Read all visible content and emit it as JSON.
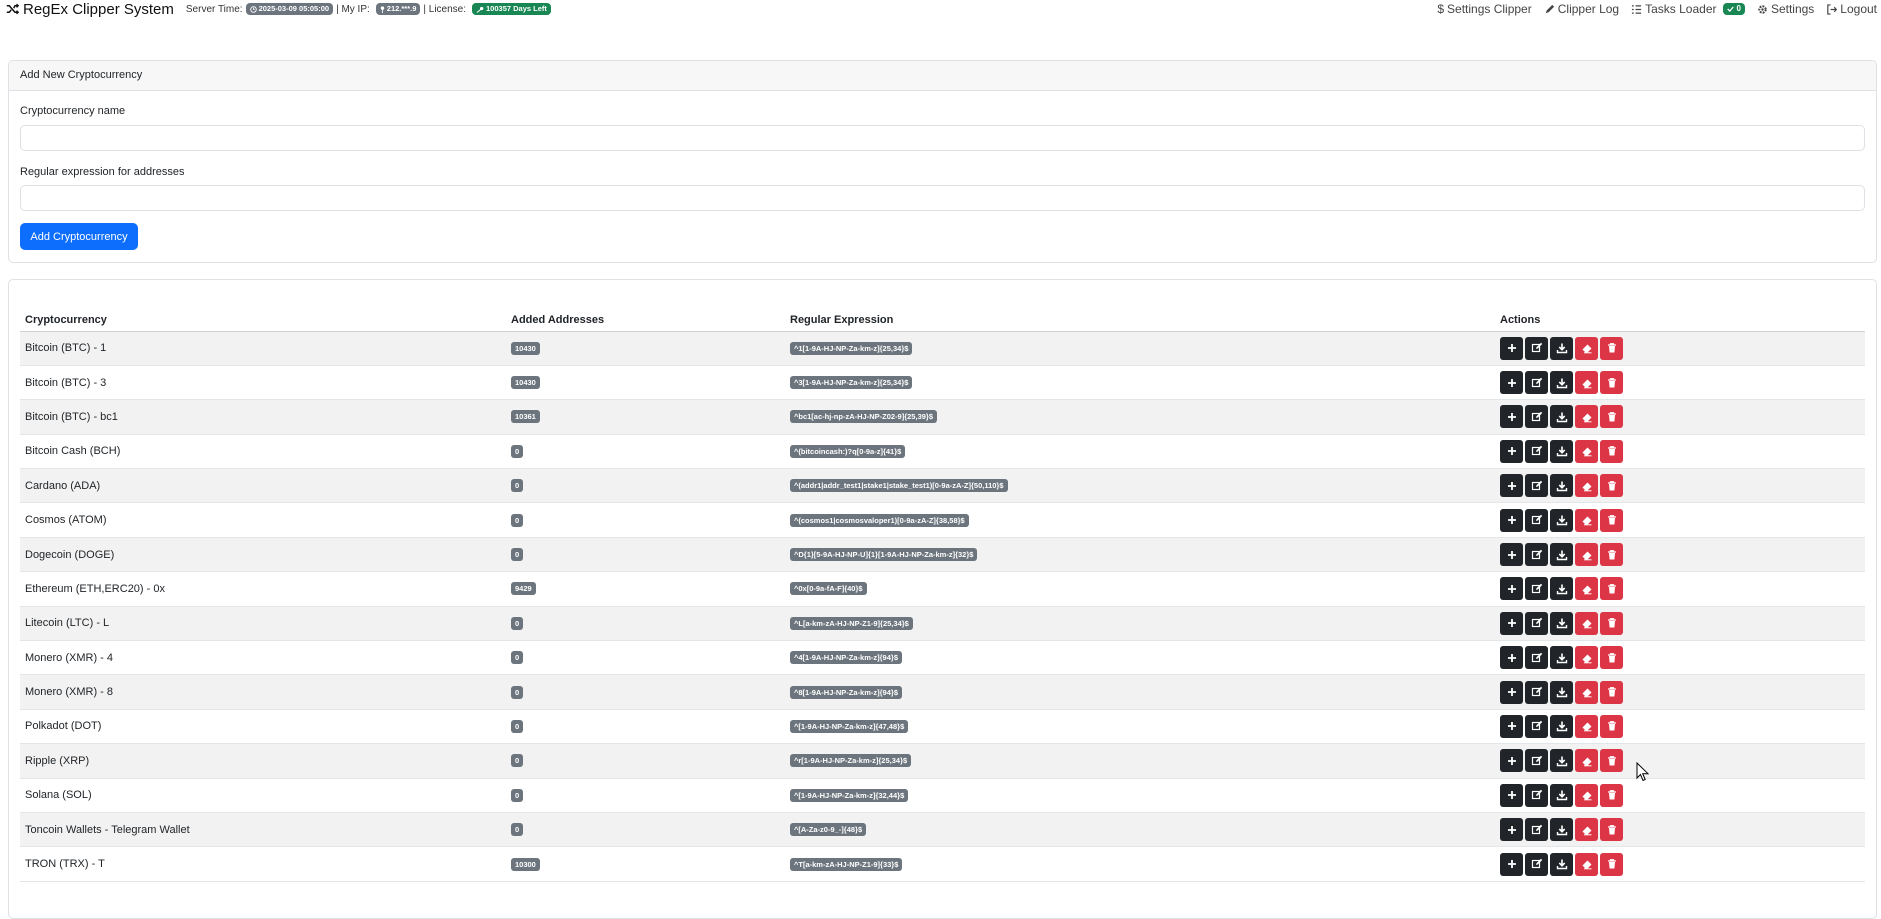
{
  "nav": {
    "brand": "RegEx Clipper System",
    "server_time_label": "Server Time:",
    "server_time": "2025-03-09 05:05:00",
    "ip_label": "| My IP:",
    "ip": "212.***.9",
    "license_label": "| License:",
    "license": "100357 Days Left",
    "links": {
      "settings_clipper": "Settings Clipper",
      "clipper_log": "Clipper Log",
      "tasks_loader": "Tasks Loader",
      "tasks_count": "0",
      "settings": "Settings",
      "logout": "Logout"
    }
  },
  "add_form": {
    "header": "Add New Cryptocurrency",
    "name_label": "Cryptocurrency name",
    "name_value": "",
    "regex_label": "Regular expression for addresses",
    "regex_value": "",
    "submit_label": "Add Cryptocurrency"
  },
  "table": {
    "columns": [
      "Cryptocurrency",
      "Added Addresses",
      "Regular Expression",
      "Actions"
    ],
    "rows": [
      {
        "name": "Bitcoin (BTC) - 1",
        "count": "10430",
        "regex": "^1[1-9A-HJ-NP-Za-km-z]{25,34}$"
      },
      {
        "name": "Bitcoin (BTC) - 3",
        "count": "10430",
        "regex": "^3[1-9A-HJ-NP-Za-km-z]{25,34}$"
      },
      {
        "name": "Bitcoin (BTC) - bc1",
        "count": "10361",
        "regex": "^bc1[ac-hj-np-zA-HJ-NP-Z02-9]{25,39}$"
      },
      {
        "name": "Bitcoin Cash (BCH)",
        "count": "0",
        "regex": "^(bitcoincash:)?q[0-9a-z]{41}$"
      },
      {
        "name": "Cardano (ADA)",
        "count": "0",
        "regex": "^(addr1|addr_test1|stake1|stake_test1)[0-9a-zA-Z]{50,110}$"
      },
      {
        "name": "Cosmos (ATOM)",
        "count": "0",
        "regex": "^(cosmos1|cosmosvaloper1)[0-9a-zA-Z]{38,58}$"
      },
      {
        "name": "Dogecoin (DOGE)",
        "count": "0",
        "regex": "^D{1}[5-9A-HJ-NP-U]{1}[1-9A-HJ-NP-Za-km-z]{32}$"
      },
      {
        "name": "Ethereum (ETH,ERC20) - 0x",
        "count": "9429",
        "regex": "^0x[0-9a-fA-F]{40}$"
      },
      {
        "name": "Litecoin (LTC) - L",
        "count": "0",
        "regex": "^L[a-km-zA-HJ-NP-Z1-9]{25,34}$"
      },
      {
        "name": "Monero (XMR) - 4",
        "count": "0",
        "regex": "^4[1-9A-HJ-NP-Za-km-z]{94}$"
      },
      {
        "name": "Monero (XMR) - 8",
        "count": "0",
        "regex": "^8[1-9A-HJ-NP-Za-km-z]{94}$"
      },
      {
        "name": "Polkadot (DOT)",
        "count": "0",
        "regex": "^[1-9A-HJ-NP-Za-km-z]{47,48}$"
      },
      {
        "name": "Ripple (XRP)",
        "count": "0",
        "regex": "^r[1-9A-HJ-NP-Za-km-z]{25,34}$"
      },
      {
        "name": "Solana (SOL)",
        "count": "0",
        "regex": "^[1-9A-HJ-NP-Za-km-z]{32,44}$"
      },
      {
        "name": "Toncoin Wallets - Telegram Wallet",
        "count": "0",
        "regex": "^[A-Za-z0-9_-]{48}$"
      },
      {
        "name": "TRON (TRX) - T",
        "count": "10300",
        "regex": "^T[a-km-zA-HJ-NP-Z1-9]{33}$"
      }
    ],
    "action_icons": [
      "plus-icon",
      "edit-icon",
      "download-icon",
      "eraser-icon",
      "trash-icon"
    ]
  },
  "colors": {
    "primary": "#0d6efd",
    "dark": "#212529",
    "danger": "#dc3545",
    "badge_gray": "#6c757d",
    "success": "#198754"
  }
}
